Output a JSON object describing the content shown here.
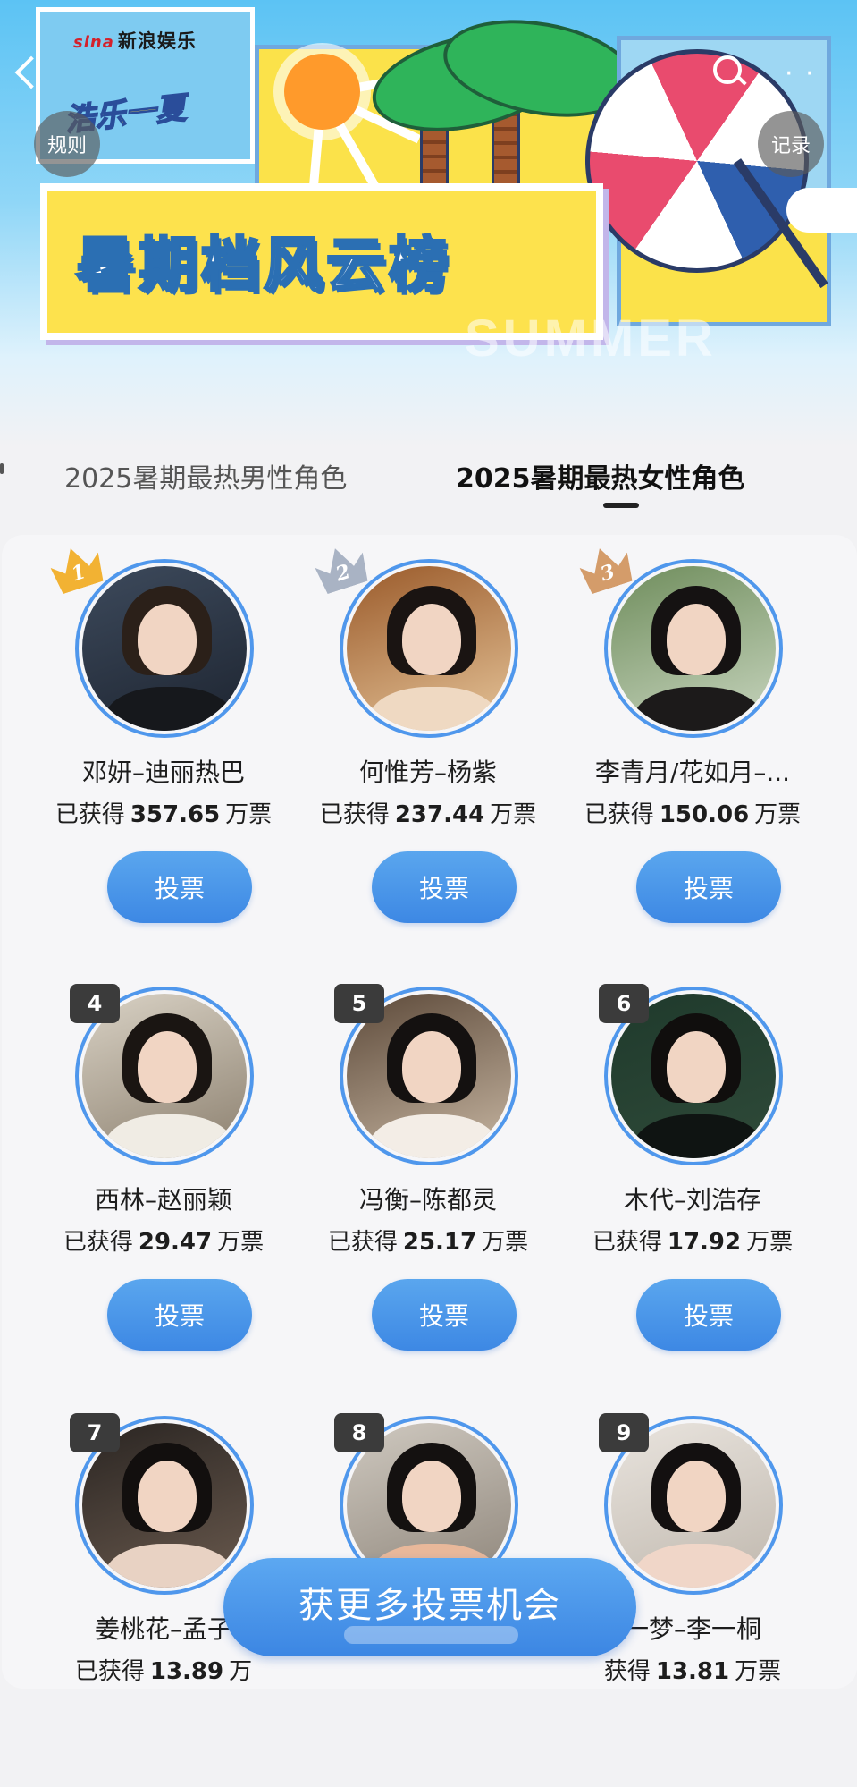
{
  "header": {
    "brand": "新浪娱乐",
    "brand_prefix": "sina",
    "tagline": "浩乐一夏",
    "title": "暑期档风云榜",
    "watermark": "SUMMER",
    "rules_label": "规则",
    "records_label": "记录"
  },
  "tabs": [
    {
      "label": "2025暑期最热男性角色",
      "active": false
    },
    {
      "label": "2025暑期最热女性角色",
      "active": true
    }
  ],
  "candidates": [
    {
      "rank": "1",
      "name": "邓妍–迪丽热巴",
      "votes_prefix": "已获得",
      "votes": "357.65",
      "votes_unit": "万票",
      "vote_label": "投票"
    },
    {
      "rank": "2",
      "name": "何惟芳–杨紫",
      "votes_prefix": "已获得",
      "votes": "237.44",
      "votes_unit": "万票",
      "vote_label": "投票"
    },
    {
      "rank": "3",
      "name": "李青月/花如月–...",
      "votes_prefix": "已获得",
      "votes": "150.06",
      "votes_unit": "万票",
      "vote_label": "投票"
    },
    {
      "rank": "4",
      "name": "西林–赵丽颖",
      "votes_prefix": "已获得",
      "votes": "29.47",
      "votes_unit": "万票",
      "vote_label": "投票"
    },
    {
      "rank": "5",
      "name": "冯衡–陈都灵",
      "votes_prefix": "已获得",
      "votes": "25.17",
      "votes_unit": "万票",
      "vote_label": "投票"
    },
    {
      "rank": "6",
      "name": "木代–刘浩存",
      "votes_prefix": "已获得",
      "votes": "17.92",
      "votes_unit": "万票",
      "vote_label": "投票"
    },
    {
      "rank": "7",
      "name": "姜桃花–孟子",
      "votes_prefix": "已获得",
      "votes": "13.89",
      "votes_unit": "万",
      "vote_label": ""
    },
    {
      "rank": "8",
      "name": "",
      "votes_prefix": "",
      "votes": "",
      "votes_unit": "",
      "vote_label": ""
    },
    {
      "rank": "9",
      "name": "一梦–李一桐",
      "votes_prefix": "获得",
      "votes": "13.81",
      "votes_unit": "万票",
      "vote_label": ""
    }
  ],
  "cta": {
    "label": "获更多投票机会"
  },
  "colors": {
    "accent": "#3d88e4",
    "gold": "#f2b233",
    "silver": "#a9b3c4",
    "bronze": "#d49c6a",
    "rank_box": "#3b3b3b"
  }
}
